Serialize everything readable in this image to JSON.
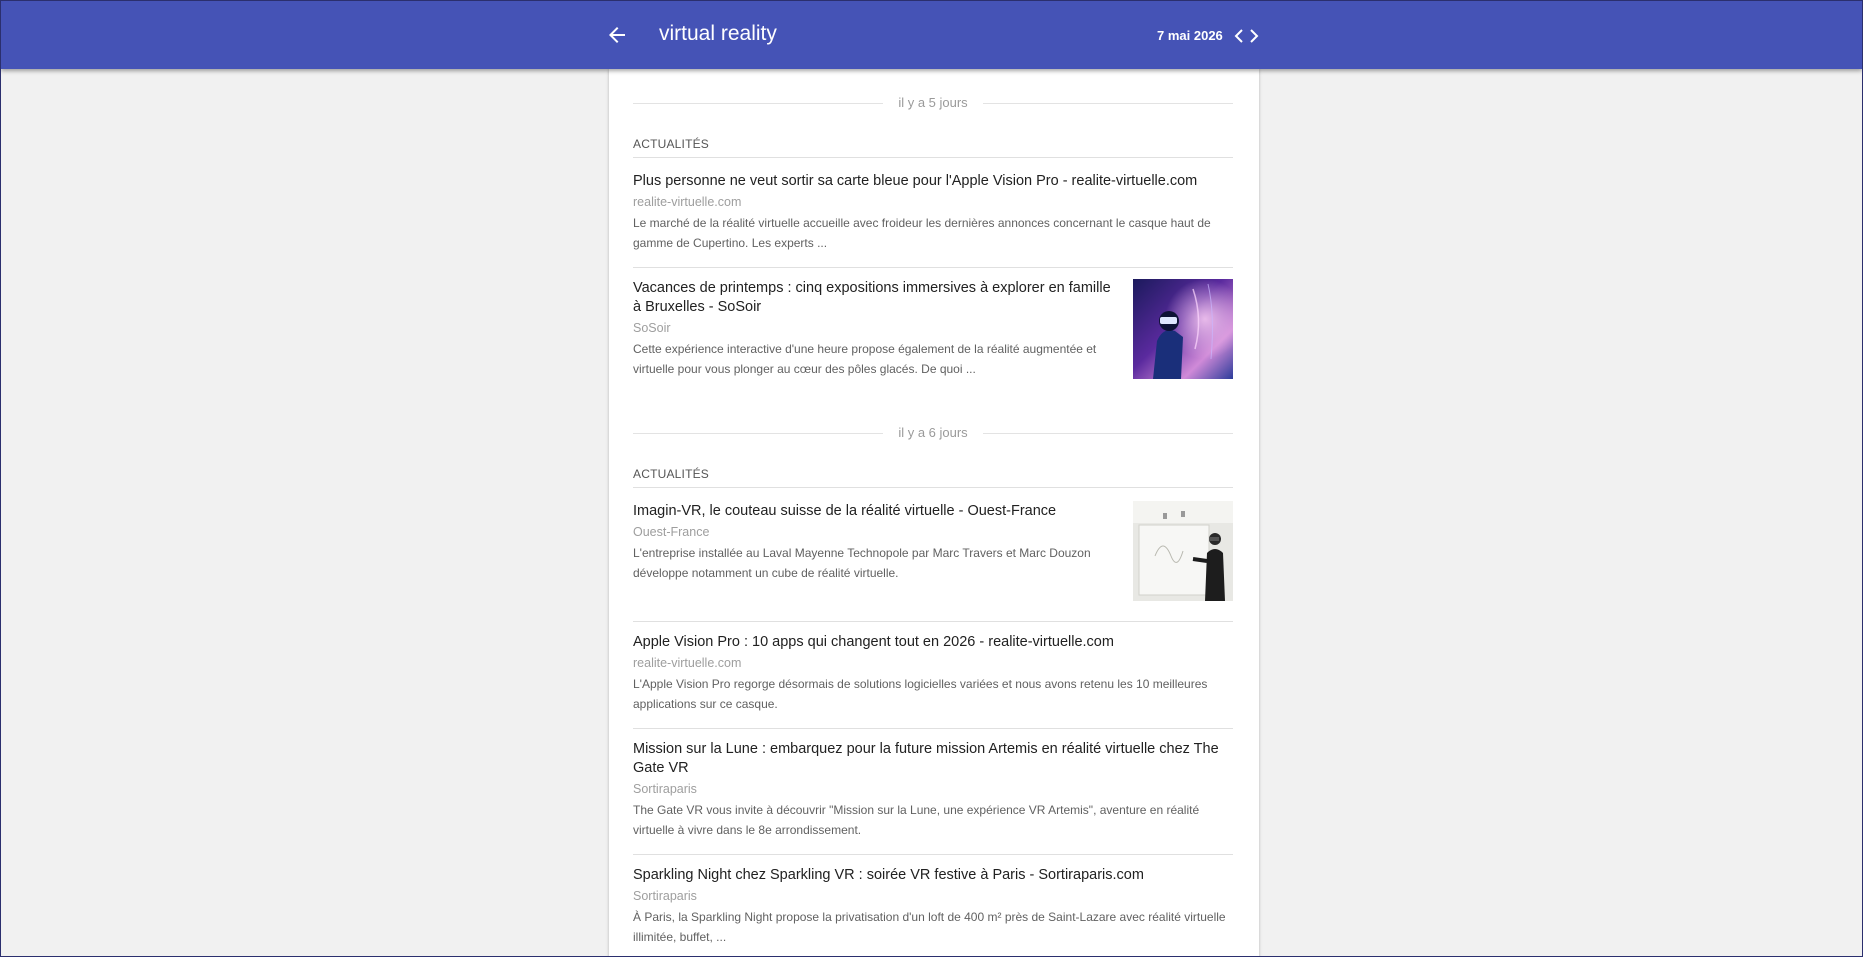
{
  "header": {
    "title": "virtual reality",
    "date": "7 mai 2026",
    "colors": {
      "bar": "#4553b6",
      "text": "#ffffff"
    },
    "icons": {
      "back": "arrow-left-icon",
      "prev": "chevron-left-icon",
      "next": "chevron-right-icon"
    }
  },
  "groups": [
    {
      "day_label": "il y a 5 jours",
      "section_label": "ACTUALITÉS",
      "articles": [
        {
          "title": "Plus personne ne veut sortir sa carte bleue pour l'Apple Vision Pro - realite-virtuelle.com",
          "source": "realite-virtuelle.com",
          "snippet": "Le marché de la réalité virtuelle accueille avec froideur les dernières annonces concernant le casque haut de gamme de Cupertino. Les experts ..."
        },
        {
          "title": "Vacances de printemps : cinq expositions immersives à explorer en famille à Bruxelles - SoSoir",
          "source": "SoSoir",
          "snippet": "Cette expérience interactive d'une heure propose également de la réalité augmentée et virtuelle pour vous plonger au cœur des pôles glacés. De quoi ..."
        }
      ]
    },
    {
      "day_label": "il y a 6 jours",
      "section_label": "ACTUALITÉS",
      "articles": [
        {
          "title": "Imagin-VR, le couteau suisse de la réalité virtuelle - Ouest-France",
          "source": "Ouest-France",
          "snippet": "L'entreprise installée au Laval Mayenne Technopole par Marc Travers et Marc Douzon développe notamment un cube de réalité virtuelle."
        },
        {
          "title": "Apple Vision Pro : 10 apps qui changent tout en 2026 - realite-virtuelle.com",
          "source": "realite-virtuelle.com",
          "snippet": "L'Apple Vision Pro regorge désormais de solutions logicielles variées et nous avons retenu les 10 meilleures applications sur ce casque."
        },
        {
          "title": "Mission sur la Lune : embarquez pour la future mission Artemis en réalité virtuelle chez The Gate VR",
          "source": "Sortiraparis",
          "snippet": "The Gate VR vous invite à découvrir \"Mission sur la Lune, une expérience VR Artemis\", aventure en réalité virtuelle à vivre dans le 8e arrondissement."
        },
        {
          "title": "Sparkling Night chez Sparkling VR : soirée VR festive à Paris - Sortiraparis.com",
          "source": "Sortiraparis",
          "snippet": "À Paris, la Sparkling Night propose la privatisation d'un loft de 400 m² près de Saint-Lazare avec réalité virtuelle illimitée, buffet, ..."
        }
      ]
    }
  ]
}
